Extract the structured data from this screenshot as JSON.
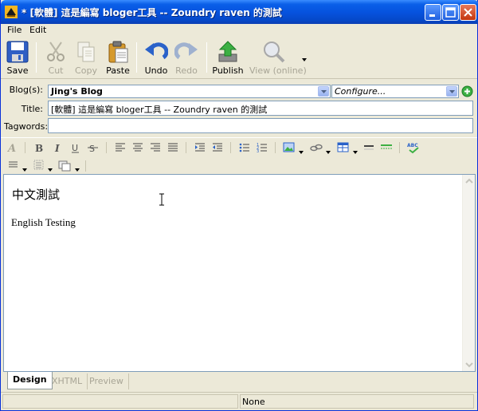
{
  "window": {
    "title": "* [軟體] 這是編寫 bloger工具 -- Zoundry raven 的測試"
  },
  "menu": [
    "File",
    "Edit"
  ],
  "toolbar": {
    "save": "Save",
    "cut": "Cut",
    "copy": "Copy",
    "paste": "Paste",
    "undo": "Undo",
    "redo": "Redo",
    "publish": "Publish",
    "view_online": "View (online)"
  },
  "form": {
    "blogs_label": "Blog(s):",
    "blog_value": "Jing's Blog",
    "configure_value": "Configure...",
    "title_label": "Title:",
    "title_value": "[軟體] 這是編寫 bloger工具 --  Zoundry raven 的測試",
    "tagwords_label": "Tagwords:",
    "tagwords_value": ""
  },
  "editor": {
    "line1": "中文測試",
    "line2": "English Testing"
  },
  "tabs": [
    "Design",
    "XHTML",
    "Preview"
  ],
  "status": {
    "text": "None"
  },
  "colors": {
    "titlebar": "#0653df",
    "window_bg": "#ece9d8",
    "accent_green": "#2ca02c"
  }
}
